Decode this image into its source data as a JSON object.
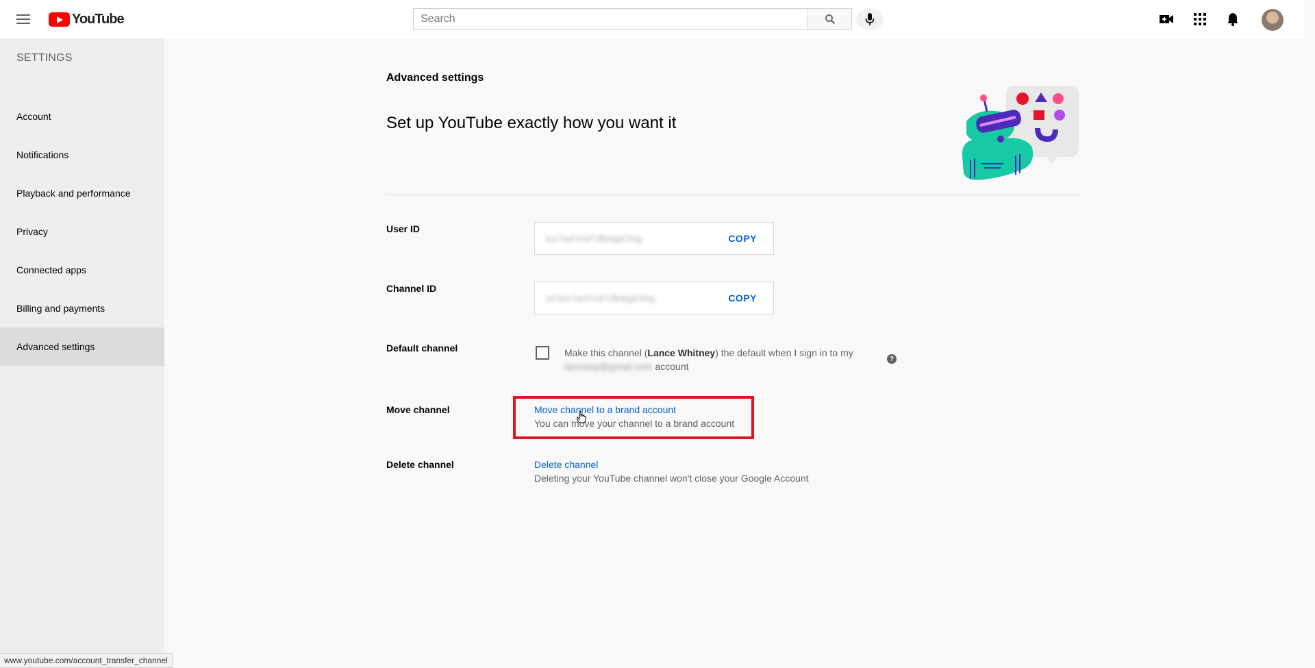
{
  "header": {
    "logo_text": "YouTube",
    "search_placeholder": "Search"
  },
  "sidebar": {
    "heading": "SETTINGS",
    "items": [
      {
        "label": "Account",
        "active": false
      },
      {
        "label": "Notifications",
        "active": false
      },
      {
        "label": "Playback and performance",
        "active": false
      },
      {
        "label": "Privacy",
        "active": false
      },
      {
        "label": "Connected apps",
        "active": false
      },
      {
        "label": "Billing and payments",
        "active": false
      },
      {
        "label": "Advanced settings",
        "active": true
      }
    ]
  },
  "main": {
    "title": "Advanced settings",
    "heading": "Set up YouTube exactly how you want it",
    "user_id": {
      "label": "User ID",
      "value": "bzr7w4YmFVfbrbgtCKtg",
      "copy_label": "COPY"
    },
    "channel_id": {
      "label": "Channel ID",
      "value": "UCbzr7w4YmFVfbrbgtCKtg",
      "copy_label": "COPY"
    },
    "default_channel": {
      "label": "Default channel",
      "text_before": "Make this channel (",
      "channel_name": "Lance Whitney",
      "text_after": ") the default when I sign in to my",
      "email_blurred": "lancewy@gmail.com",
      "text_end": "account",
      "checked": false,
      "help_symbol": "?"
    },
    "move_channel": {
      "label": "Move channel",
      "link": "Move channel to a brand account",
      "description": "You can move your channel to a brand account"
    },
    "delete_channel": {
      "label": "Delete channel",
      "link": "Delete channel",
      "description": "Deleting your YouTube channel won't close your Google Account"
    }
  },
  "status_bar": {
    "url": "www.youtube.com/account_transfer_channel"
  },
  "colors": {
    "brand_red": "#ff0000",
    "link_blue": "#065fd4",
    "highlight_red": "#e0131f"
  }
}
